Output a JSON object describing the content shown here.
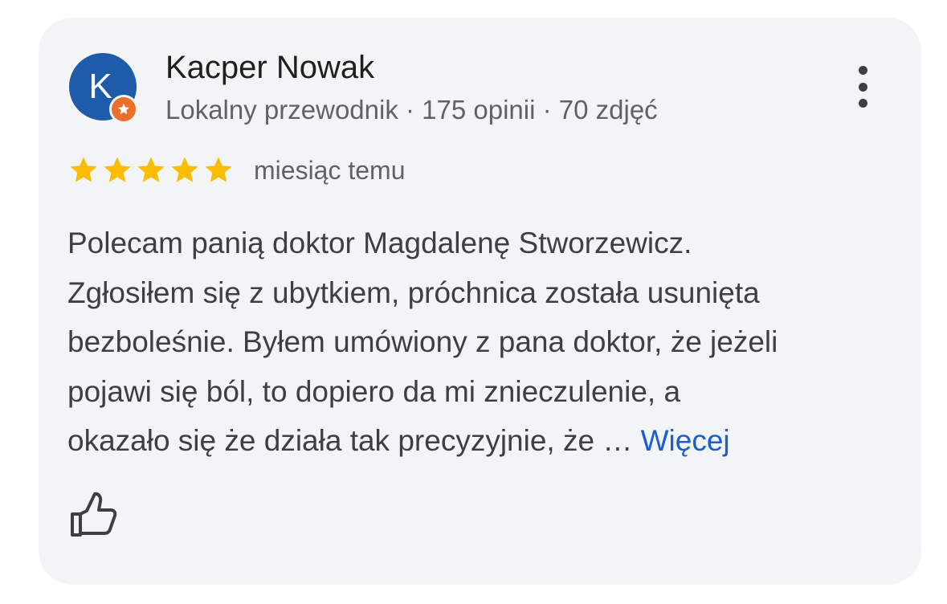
{
  "review": {
    "author": {
      "initial": "K",
      "name": "Kacper Nowak",
      "meta": "Lokalny przewodnik · 175 opinii · 70 zdjęć",
      "avatar_color": "#1e5cab",
      "badge_color": "#e8702a",
      "badge_icon": "local-guide-star-icon"
    },
    "rating": {
      "stars": 5,
      "max": 5,
      "star_color": "#fbbc04"
    },
    "date": "miesiąc temu",
    "text_lines": [
      "Polecam panią doktor Magdalenę Stworzewicz.",
      "Zgłosiłem się z ubytkiem, próchnica została usunięta",
      "bezboleśnie. Byłem umówiony z pana doktor, że jeżeli",
      "pojawi się ból, to dopiero da mi znieczulenie, a",
      "okazało się że działa tak precyzyjnie, że … "
    ],
    "more_label": "Więcej",
    "link_color": "#1a5fd0",
    "actions": {
      "menu_icon": "more-vert-icon",
      "like_icon": "thumb-up-icon"
    }
  }
}
